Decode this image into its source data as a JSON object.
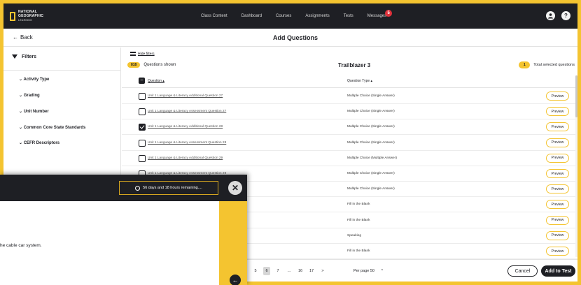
{
  "brand": {
    "logo_line1": "NATIONAL",
    "logo_line2": "GEOGRAPHIC",
    "logo_line3": "LEARNING"
  },
  "nav": {
    "links": [
      "Class Content",
      "Dashboard",
      "Courses",
      "Assignments",
      "Tests",
      "Messages"
    ],
    "messages_badge": "5",
    "account_icon": "account-icon",
    "help_icon": "help-icon"
  },
  "header": {
    "back_label": "Back",
    "back_arrow": "←",
    "title": "Add Questions"
  },
  "filters": {
    "heading": "Filters",
    "items": [
      "Activity Type",
      "Grading",
      "Unit Number",
      "Common Core State Standards",
      "CEFR Descriptors"
    ]
  },
  "main": {
    "hide_filters_label": "Hide filters",
    "shown_count": "818",
    "shown_label": "Questions shown",
    "test_name": "Trailblazer 3",
    "selected_count": "1",
    "selected_label": "Total selected questions",
    "col_question": "Question ▴",
    "col_type": "Question Type ▴",
    "preview_label": "Preview"
  },
  "rows": [
    {
      "question": "Unit 1 Language & Literacy Additional Question 27",
      "type": "Multiple Choice (Single Answer)",
      "checked": false
    },
    {
      "question": "Unit 1 Language & Literacy Assessment Question 27",
      "type": "Multiple Choice (Single Answer)",
      "checked": false
    },
    {
      "question": "Unit 1 Language & Literacy Additional Question 28",
      "type": "Multiple Choice (Single Answer)",
      "checked": true
    },
    {
      "question": "Unit 1 Language & Literacy Assessment Question 28",
      "type": "Multiple Choice (Single Answer)",
      "checked": false
    },
    {
      "question": "Unit 1 Language & Literacy Additional Question 29",
      "type": "Multiple Choice (Multiple Answer)",
      "checked": false
    },
    {
      "question": "Unit 1 Language & Literacy Assessment Question 29",
      "type": "Multiple Choice (Single Answer)",
      "checked": false
    },
    {
      "question": "",
      "type": "Multiple Choice (Single Answer)",
      "checked": false
    },
    {
      "question": "",
      "type": "Fill in the Blank",
      "checked": false
    },
    {
      "question": "",
      "type": "Fill in the Blank",
      "checked": false
    },
    {
      "question": "",
      "type": "Speaking",
      "checked": false
    },
    {
      "question": "",
      "type": "Fill in the Blank",
      "checked": false
    }
  ],
  "pagination": {
    "pages": [
      "5",
      "6",
      "7",
      "...",
      "16",
      "17",
      ">"
    ],
    "active_page": "6",
    "per_page_label": "Per page 50",
    "per_page_chevron": "^"
  },
  "footer": {
    "cancel_label": "Cancel",
    "add_label": "Add to Test"
  },
  "overlay": {
    "timer_text": "56 days and 18 hours remaining....",
    "close_glyph": "✕",
    "body_text": "he cable car system.",
    "arrow_glyph": "←"
  },
  "colors": {
    "accent": "#f4c430",
    "dark": "#1e1f24",
    "badge": "#e0313b"
  }
}
